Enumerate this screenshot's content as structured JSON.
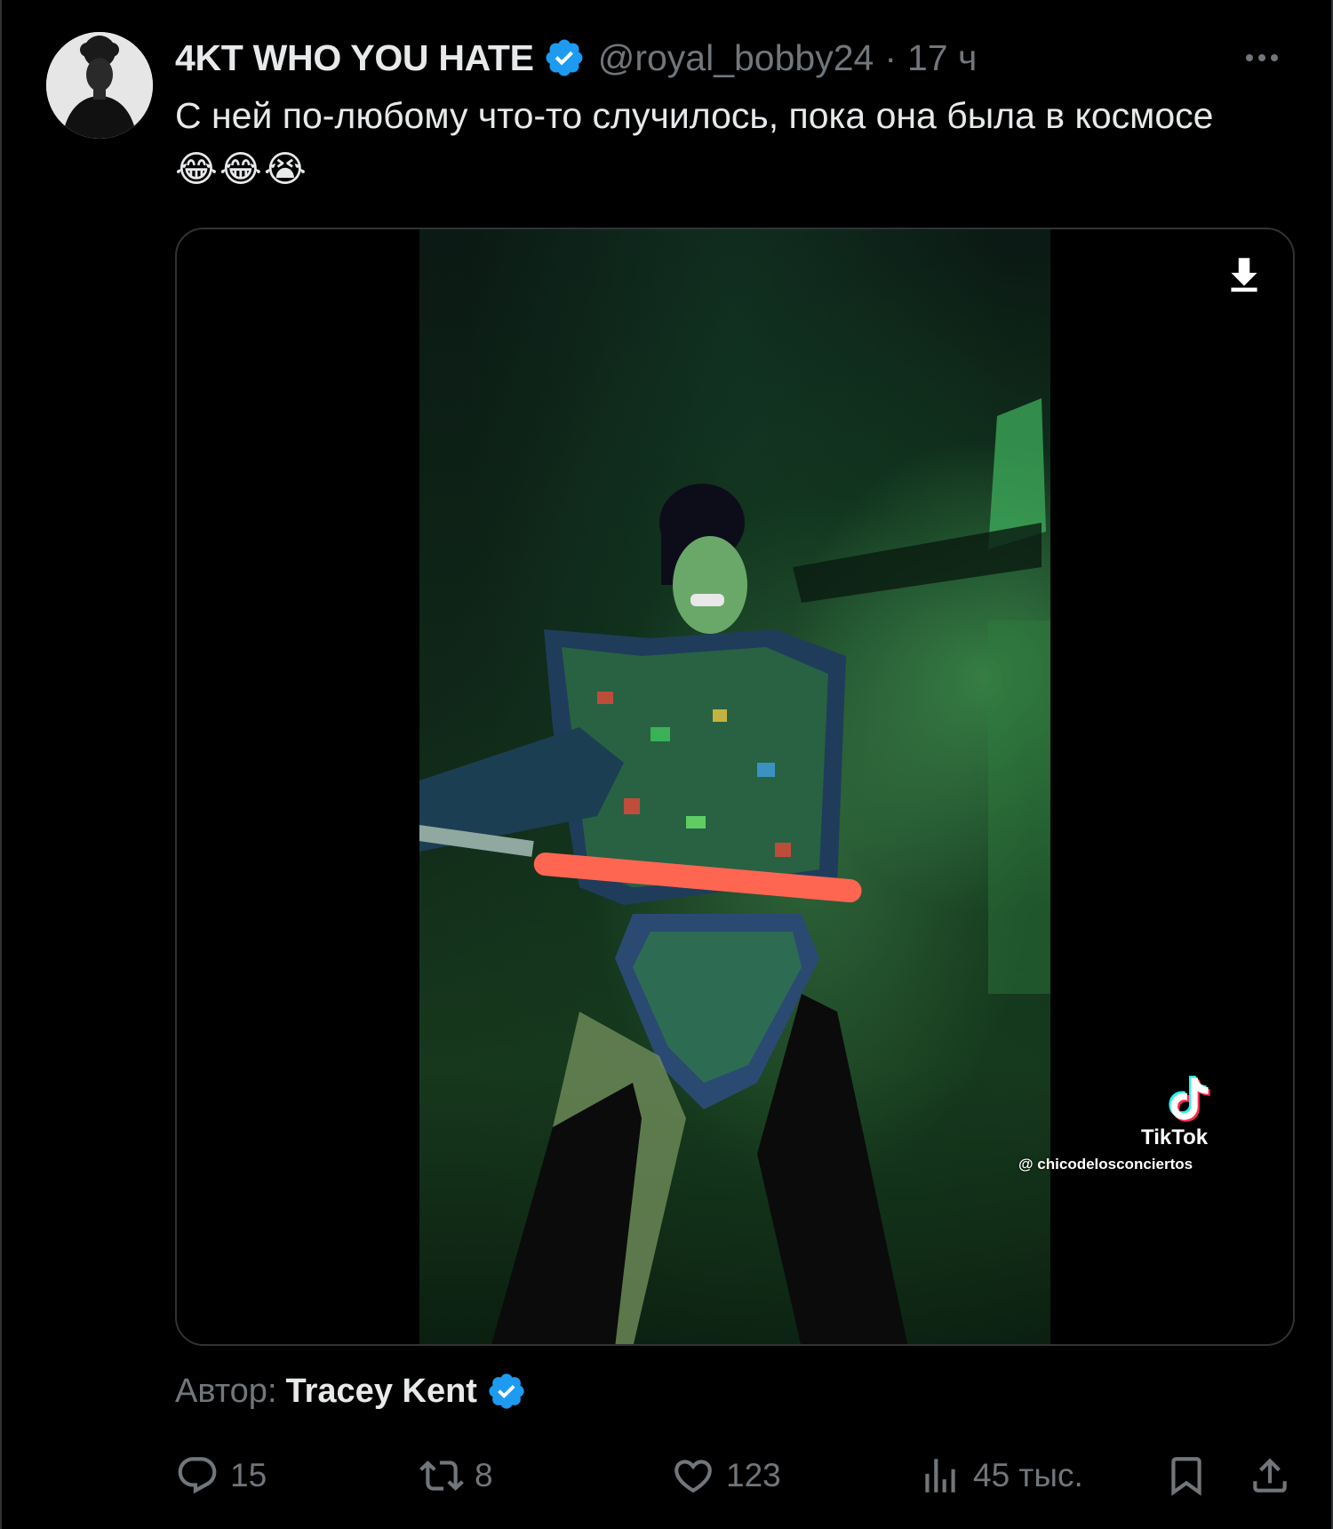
{
  "tweet": {
    "author": {
      "display_name": "4KT WHO YOU HATE",
      "handle": "@royal_bobby24",
      "separator": "·",
      "timestamp": "17 ч",
      "verified": true
    },
    "text": "С ней по-любому что-то случилось, пока она была в космосе",
    "text_emojis": "😂😂😭",
    "media": {
      "type": "video",
      "watermark": {
        "brand": "TikTok",
        "username": "@ chicodelosconciertos"
      }
    },
    "attribution": {
      "label": "Автор:",
      "name": "Tracey Kent",
      "verified": true
    },
    "actions": {
      "replies": "15",
      "reposts": "8",
      "likes": "123",
      "views": "45 тыс."
    }
  },
  "icons": {
    "more": "more-horizontal-icon",
    "download": "download-icon",
    "verified": "verified-badge-icon",
    "reply": "reply-icon",
    "repost": "repost-icon",
    "like": "heart-icon",
    "views": "views-icon",
    "bookmark": "bookmark-icon",
    "share": "share-icon",
    "tiktok": "tiktok-logo-icon"
  },
  "colors": {
    "background": "#000000",
    "text_primary": "#e7e9ea",
    "text_secondary": "#71767b",
    "verified_blue": "#1d9bf0",
    "border": "#2f3336"
  }
}
